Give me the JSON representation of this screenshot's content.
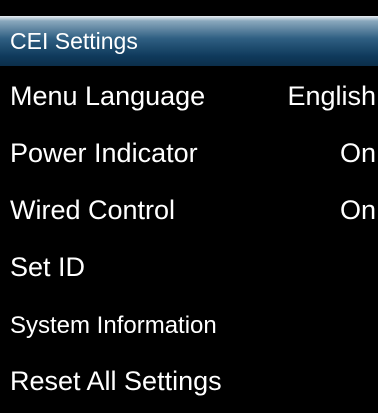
{
  "header": {
    "title": "CEI Settings"
  },
  "menu": {
    "items": [
      {
        "label": "Menu Language",
        "value": "English"
      },
      {
        "label": "Power Indicator",
        "value": "On"
      },
      {
        "label": "Wired Control",
        "value": "On"
      },
      {
        "label": "Set ID",
        "value": ""
      },
      {
        "label": "System Information",
        "value": ""
      },
      {
        "label": "Reset All Settings",
        "value": ""
      }
    ]
  },
  "colors": {
    "background": "#000000",
    "header_gradient_top": "#e8eef3",
    "header_gradient_bottom": "#0b2e4a",
    "text": "#ffffff"
  }
}
